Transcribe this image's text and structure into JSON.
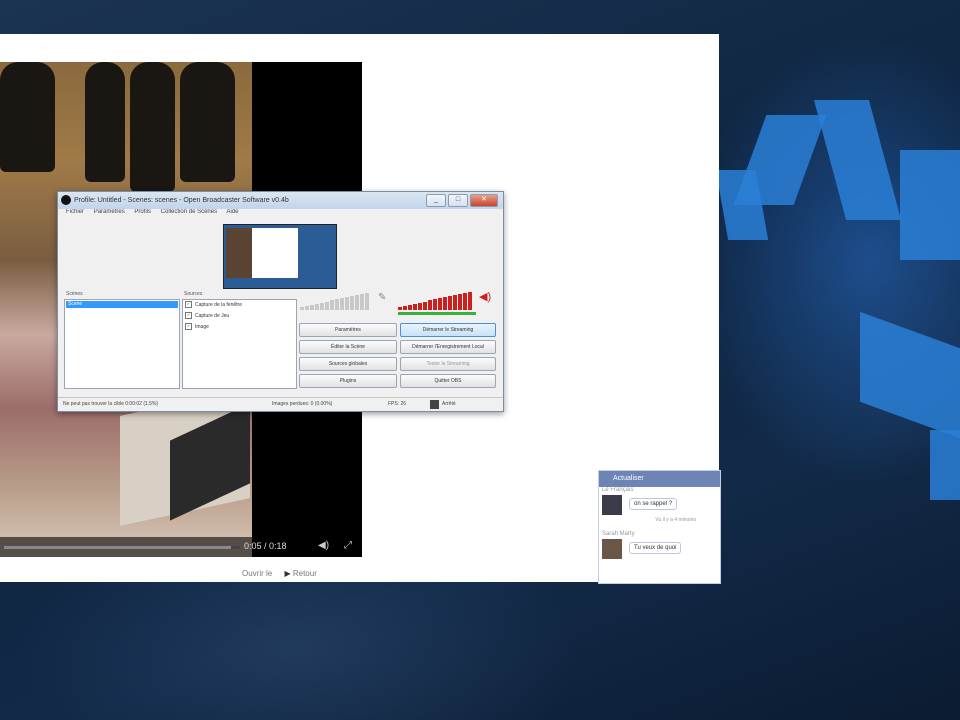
{
  "below_video": {
    "left_text": "Ouvrir le",
    "right_text": "Retour"
  },
  "video": {
    "time": "0:05 / 0:18",
    "progress": 0.96
  },
  "chat": {
    "header": "Actualiser",
    "first_meta": "Le Français",
    "first_message": "on se rappel ?",
    "first_sub": "Vu il y a 4 minutes",
    "second_meta": "Sarah Marty",
    "second_message": "Tu veux de quoi"
  },
  "obs": {
    "title": "Profile: Untitled - Scenes: scenes - Open Broadcaster Software v0.4b",
    "menu": [
      "Fichier",
      "Paramètres",
      "Profils",
      "Collection de Scènes",
      "Aide"
    ],
    "scenes_label": "Scènes",
    "scenes": [
      "Scene"
    ],
    "sources_label": "Sources",
    "sources": [
      {
        "label": "Capture de la fenêtre",
        "checked": true
      },
      {
        "label": "Capture de Jeu",
        "checked": true
      },
      {
        "label": "Image",
        "checked": true
      }
    ],
    "buttons": {
      "settings": "Paramètres",
      "start_stream": "Démarrer le Streaming",
      "edit_scene": "Éditer la Scène",
      "start_recording": "Démarrer l'Enregistrement Local",
      "global_sources": "Sources globales",
      "test_stream": "Tester le Streaming",
      "plugins": "Plugins",
      "quit": "Quitter OBS"
    },
    "status": {
      "dropped": "Ne peut pas trouver la cible 0:00:02 (1.5%)",
      "lost_frames": "Images perdues: 0 (0.00%)",
      "fps": "FPS: 26",
      "live_label": "Arrêté"
    }
  },
  "colors": {
    "chat_header": "#6d84b4",
    "obs_titlebar": "#c3d4ea",
    "selection": "#3399ff",
    "meter_red": "#cc1f1f",
    "desktop_accent": "#2a7fd6"
  }
}
